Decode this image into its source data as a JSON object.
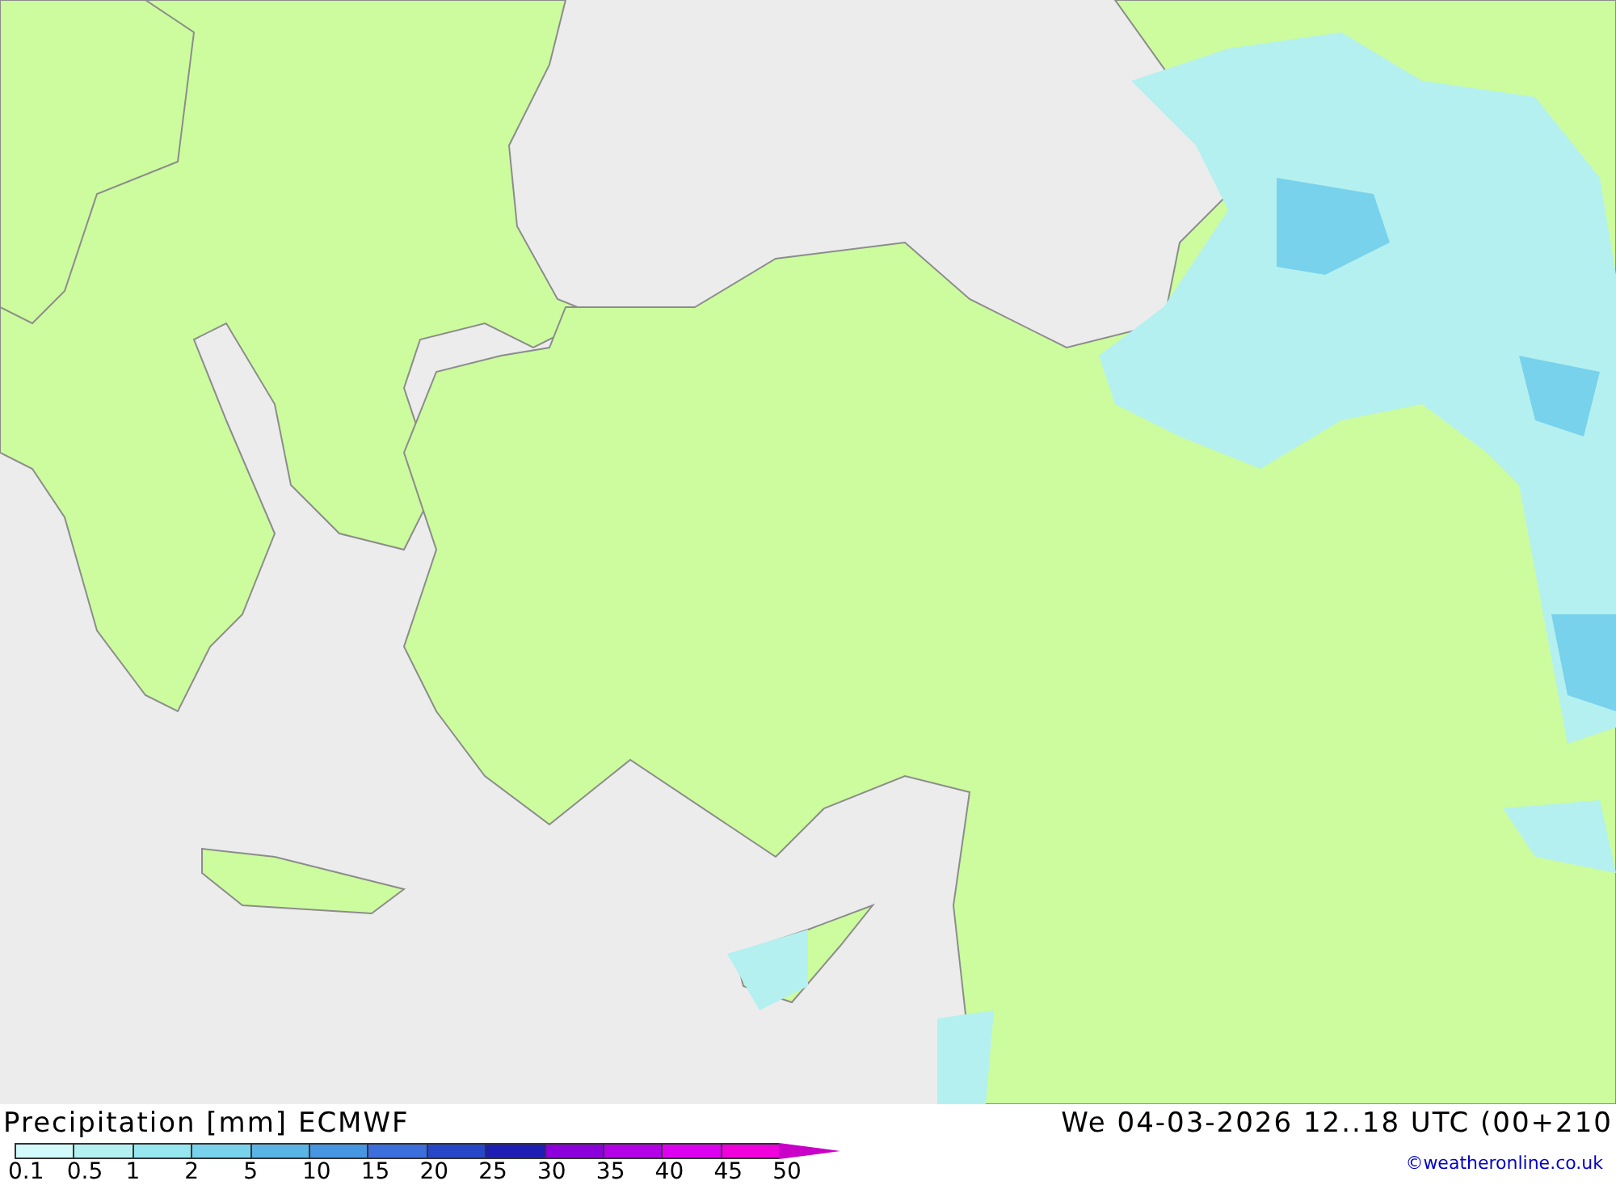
{
  "map": {
    "title": "Precipitation [mm] ECMWF",
    "valid_time": "We 04-03-2026 12..18 UTC (00+210"
  },
  "legend": [
    {
      "label": "0.1",
      "color": "#d2fafa"
    },
    {
      "label": "0.5",
      "color": "#b4f0f0"
    },
    {
      "label": "1",
      "color": "#96e6f0"
    },
    {
      "label": "2",
      "color": "#78d2eb"
    },
    {
      "label": "5",
      "color": "#5ab4e6"
    },
    {
      "label": "10",
      "color": "#4696e1"
    },
    {
      "label": "15",
      "color": "#3c6edc"
    },
    {
      "label": "20",
      "color": "#2846c8"
    },
    {
      "label": "25",
      "color": "#1e1eb4"
    },
    {
      "label": "30",
      "color": "#8c00dc"
    },
    {
      "label": "35",
      "color": "#b400e6"
    },
    {
      "label": "40",
      "color": "#dc00f0"
    },
    {
      "label": "45",
      "color": "#f000dc"
    },
    {
      "label": "50",
      "color": "#c800c8"
    }
  ],
  "credit": "©weatheronline.co.uk"
}
